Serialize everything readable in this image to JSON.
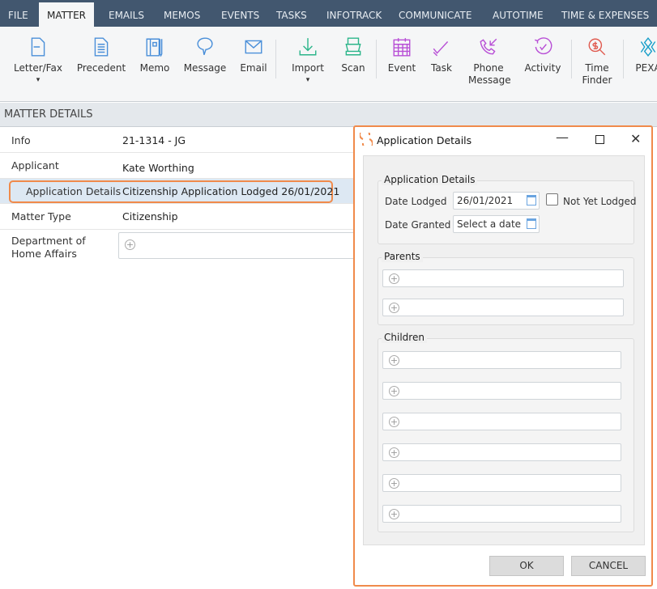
{
  "tabs": [
    "FILE",
    "MATTER",
    "EMAILS",
    "MEMOS",
    "EVENTS",
    "TASKS",
    "INFOTRACK",
    "COMMUNICATE",
    "AUTOTIME",
    "TIME & EXPENSES"
  ],
  "ribbon": [
    {
      "label": "Letter/Fax",
      "icon": "letter-icon",
      "color": "#4a8fd9",
      "dropdown": true
    },
    {
      "label": "Precedent",
      "icon": "document-icon",
      "color": "#4a8fd9"
    },
    {
      "label": "Memo",
      "icon": "notebook-icon",
      "color": "#4a8fd9"
    },
    {
      "label": "Message",
      "icon": "speech-bubble-icon",
      "color": "#4a8fd9"
    },
    {
      "label": "Email",
      "icon": "envelope-icon",
      "color": "#4a8fd9"
    },
    {
      "label": "Import",
      "icon": "download-icon",
      "color": "#2bb58a",
      "dropdown": true
    },
    {
      "label": "Scan",
      "icon": "scanner-icon",
      "color": "#2bb58a"
    },
    {
      "label": "Event",
      "icon": "calendar-icon",
      "color": "#b84fd6"
    },
    {
      "label": "Task",
      "icon": "checkmark-icon",
      "color": "#b84fd6"
    },
    {
      "label": "Phone Message",
      "icon": "phone-icon",
      "color": "#b84fd6"
    },
    {
      "label": "Activity",
      "icon": "activity-icon",
      "color": "#b84fd6"
    },
    {
      "label": "Time Finder",
      "icon": "time-finder-icon",
      "color": "#e05a4f"
    },
    {
      "label": "PEXA",
      "icon": "pexa-icon",
      "color": "#1a9fc9"
    }
  ],
  "section_title": "MATTER DETAILS",
  "details": [
    {
      "label": "Info",
      "value": "21-1314 - JG"
    },
    {
      "label": "Applicant",
      "value": "Kate Worthing"
    },
    {
      "label": "Application Details",
      "value": "Citizenship Application Lodged 26/01/2021"
    },
    {
      "label": "Matter Type",
      "value": "Citizenship"
    },
    {
      "label": "Department of Home Affairs",
      "value": ""
    }
  ],
  "dialog": {
    "title": "Application Details",
    "group_app": "Application Details",
    "date_lodged_label": "Date Lodged",
    "date_lodged": "26/01/2021",
    "not_yet_lodged": "Not Yet Lodged",
    "date_granted_label": "Date Granted",
    "date_granted_placeholder": "Select a date",
    "parents": "Parents",
    "children": "Children",
    "ok": "OK",
    "cancel": "CANCEL"
  },
  "accent": "#f08a4b"
}
